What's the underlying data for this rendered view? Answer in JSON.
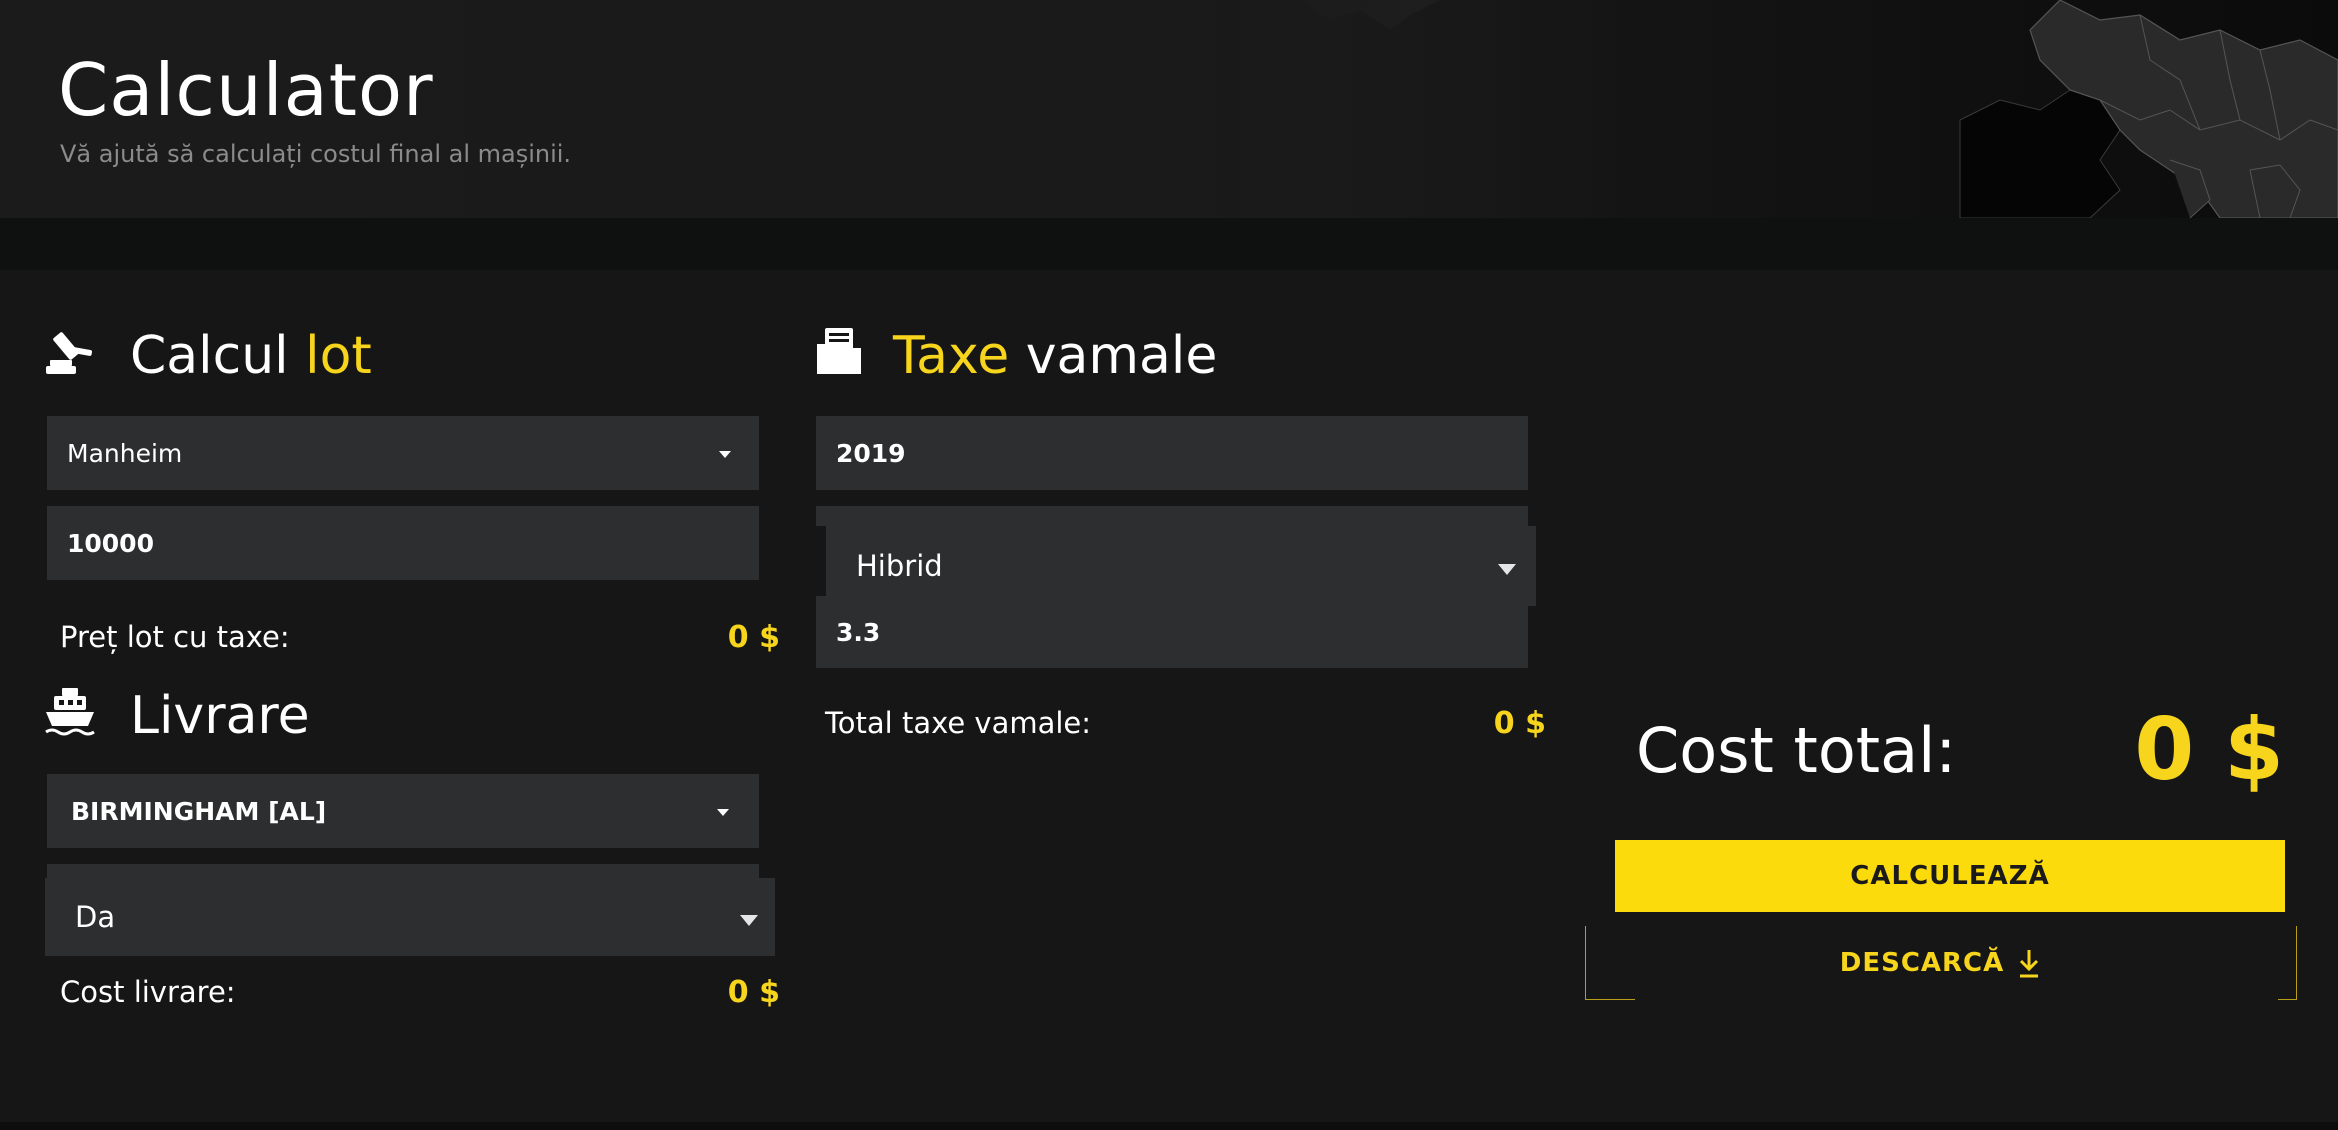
{
  "header": {
    "title": "Calculator",
    "subtitle": "Vă ajută să calculați costul final al mașinii."
  },
  "lot": {
    "title_main": "Calcul",
    "title_accent": "lot",
    "auction_select": "Manheim",
    "price_input": "10000",
    "summary_label": "Preț lot cu taxe:",
    "summary_value": "0 $"
  },
  "delivery": {
    "title": "Livrare",
    "location_select": "BIRMINGHAM [AL]",
    "option_select": "Da",
    "summary_label": "Cost livrare:",
    "summary_value": "0 $"
  },
  "customs": {
    "title_accent": "Taxe",
    "title_main": "vamale",
    "year_input": "2019",
    "fuel_select": "Hibrid",
    "engine_input": "3.3",
    "summary_label": "Total taxe vamale:",
    "summary_value": "0 $"
  },
  "total": {
    "label": "Cost total:",
    "value": "0 $",
    "calculate_button": "CALCULEAZĂ",
    "download_button": "DESCARCĂ"
  },
  "colors": {
    "accent": "#f7d51c",
    "button": "#fcdb0c",
    "field_bg": "#2c2e2f",
    "page_bg": "#161616"
  },
  "icons": {
    "lot": "gavel-icon",
    "delivery": "ship-icon",
    "customs": "folder-icon",
    "download": "download-arrow-icon"
  }
}
